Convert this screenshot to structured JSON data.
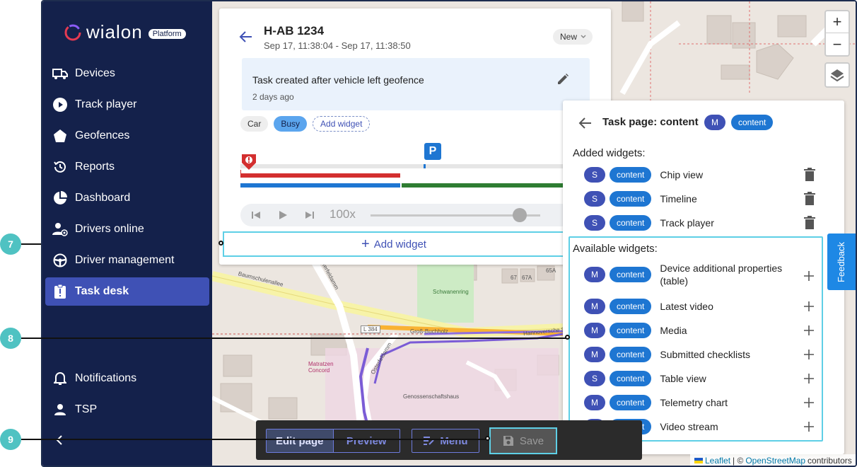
{
  "brand": {
    "name": "wialon",
    "badge": "Platform"
  },
  "nav": {
    "items": [
      {
        "label": "Devices",
        "icon": "truck-icon"
      },
      {
        "label": "Track player",
        "icon": "play-circle-icon"
      },
      {
        "label": "Geofences",
        "icon": "pentagon-icon"
      },
      {
        "label": "Reports",
        "icon": "history-icon"
      },
      {
        "label": "Dashboard",
        "icon": "pie-chart-icon"
      },
      {
        "label": "Drivers online",
        "icon": "driver-online-icon"
      },
      {
        "label": "Driver management",
        "icon": "steering-wheel-icon"
      },
      {
        "label": "Task desk",
        "icon": "clipboard-alert-icon"
      }
    ],
    "active_index": 7,
    "bottom": [
      {
        "label": "Notifications",
        "icon": "bell-icon"
      },
      {
        "label": "TSP",
        "icon": "person-icon"
      }
    ]
  },
  "task": {
    "title": "H-AB 1234",
    "period": "Sep 17, 11:38:04 - Sep 17, 11:38:50",
    "status": "New",
    "note_text": "Task created after vehicle left geofence",
    "note_time": "2 days ago",
    "chips": [
      "Car",
      "Busy"
    ],
    "add_widget_chip": "Add widget",
    "parking_marker": "P",
    "player_speed": "100x",
    "player_position": 0.88,
    "add_widget_bar": "Add widget"
  },
  "panel": {
    "title": "Task page: content",
    "title_badges": [
      "M",
      "content"
    ],
    "added_heading": "Added widgets:",
    "added": [
      {
        "size": "S",
        "tag": "content",
        "label": "Chip view"
      },
      {
        "size": "S",
        "tag": "content",
        "label": "Timeline"
      },
      {
        "size": "S",
        "tag": "content",
        "label": "Track player"
      }
    ],
    "available_heading": "Available widgets:",
    "available": [
      {
        "size": "M",
        "tag": "content",
        "label": "Device additional properties (table)"
      },
      {
        "size": "M",
        "tag": "content",
        "label": "Latest video"
      },
      {
        "size": "M",
        "tag": "content",
        "label": "Media"
      },
      {
        "size": "M",
        "tag": "content",
        "label": "Submitted checklists"
      },
      {
        "size": "S",
        "tag": "content",
        "label": "Table view"
      },
      {
        "size": "M",
        "tag": "content",
        "label": "Telemetry chart"
      },
      {
        "size": "M",
        "tag": "content",
        "label": "Video stream"
      }
    ]
  },
  "feedback": "Feedback",
  "zoom": {
    "in": "+",
    "out": "−"
  },
  "toolbar": {
    "edit": "Edit page",
    "preview": "Preview",
    "menu": "Menu",
    "save": "Save"
  },
  "attribution": {
    "leaflet": "Leaflet",
    "sep": "| ©",
    "osm": "OpenStreetMap",
    "suffix": "contributors"
  },
  "map_labels": {
    "street1": "Baumschulenallee",
    "street2": "Osterfeldamm",
    "park": "Schwanenring",
    "road": "L 384",
    "street3": "Groß-Buchholz",
    "street4": "Hannoversche S",
    "street5": "Osterfeldamm",
    "place1": "Matratzen Concord",
    "place2": "Genossenschaftshaus",
    "num1": "67",
    "num2": "67A",
    "num3": "65A"
  },
  "callouts": [
    "7",
    "8",
    "9"
  ],
  "colors": {
    "sidebar": "#14214b",
    "accent": "#3f51b5",
    "chip_blue": "#1e76d2",
    "highlight": "#5ecfe6",
    "callout": "#4fc2c2"
  }
}
